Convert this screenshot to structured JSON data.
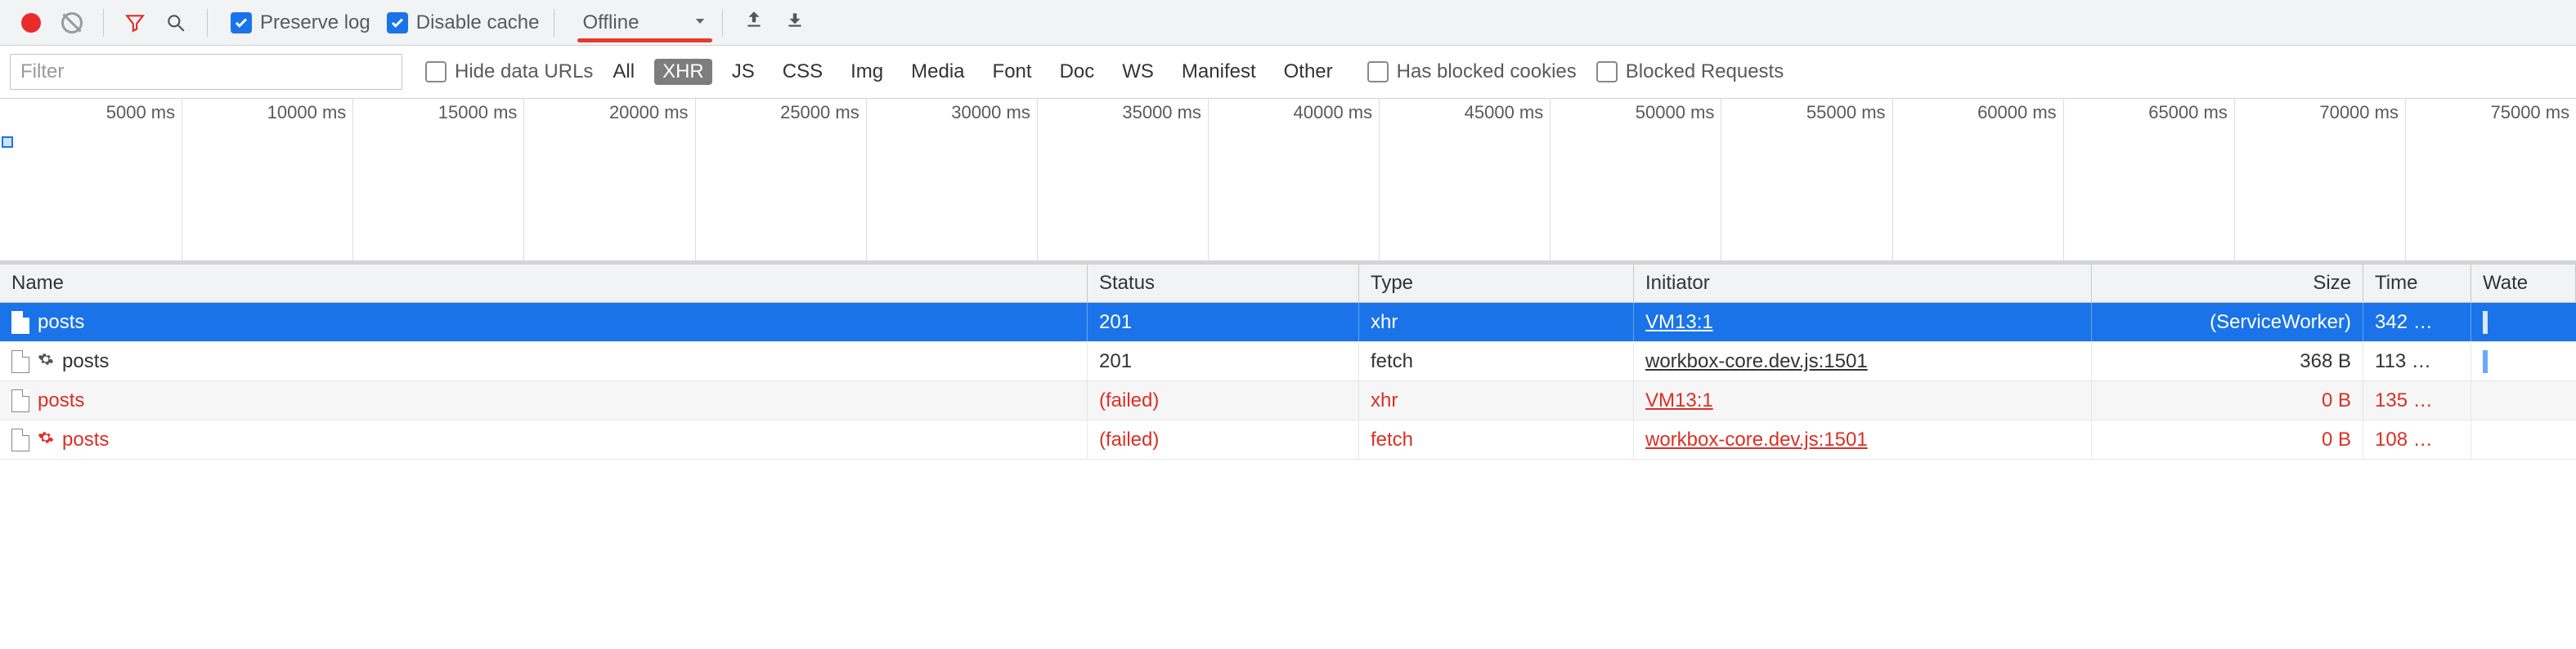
{
  "toolbar": {
    "preserve_log_label": "Preserve log",
    "preserve_log_checked": true,
    "disable_cache_label": "Disable cache",
    "disable_cache_checked": true,
    "throttling_value": "Offline",
    "icons": {
      "record": "record-icon",
      "clear": "clear-icon",
      "filter": "filter-funnel-icon",
      "search": "search-icon",
      "dropdown": "dropdown-icon",
      "upload": "upload-icon",
      "download": "download-icon"
    }
  },
  "filterbar": {
    "filter_placeholder": "Filter",
    "hide_data_urls_label": "Hide data URLs",
    "types": [
      "All",
      "XHR",
      "JS",
      "CSS",
      "Img",
      "Media",
      "Font",
      "Doc",
      "WS",
      "Manifest",
      "Other"
    ],
    "active_type": "XHR",
    "has_blocked_cookies_label": "Has blocked cookies",
    "blocked_requests_label": "Blocked Requests"
  },
  "timeline": {
    "ticks": [
      "5000 ms",
      "10000 ms",
      "15000 ms",
      "20000 ms",
      "25000 ms",
      "30000 ms",
      "35000 ms",
      "40000 ms",
      "45000 ms",
      "50000 ms",
      "55000 ms",
      "60000 ms",
      "65000 ms",
      "70000 ms",
      "75000 ms"
    ]
  },
  "table": {
    "headers": {
      "name": "Name",
      "status": "Status",
      "type": "Type",
      "initiator": "Initiator",
      "size": "Size",
      "time": "Time",
      "waterfall": "Wate"
    },
    "rows": [
      {
        "name": "posts",
        "status": "201",
        "type": "xhr",
        "initiator": "VM13:1",
        "size": "(ServiceWorker)",
        "time": "342 …",
        "selected": true,
        "failed": false,
        "gear": false,
        "wf": true
      },
      {
        "name": "posts",
        "status": "201",
        "type": "fetch",
        "initiator": "workbox-core.dev.js:1501",
        "size": "368 B",
        "time": "113 …",
        "selected": false,
        "failed": false,
        "gear": true,
        "wf": true
      },
      {
        "name": "posts",
        "status": "(failed)",
        "type": "xhr",
        "initiator": "VM13:1",
        "size": "0 B",
        "time": "135 …",
        "selected": false,
        "failed": true,
        "gear": false,
        "wf": false
      },
      {
        "name": "posts",
        "status": "(failed)",
        "type": "fetch",
        "initiator": "workbox-core.dev.js:1501",
        "size": "0 B",
        "time": "108 …",
        "selected": false,
        "failed": true,
        "gear": true,
        "wf": false
      }
    ]
  }
}
